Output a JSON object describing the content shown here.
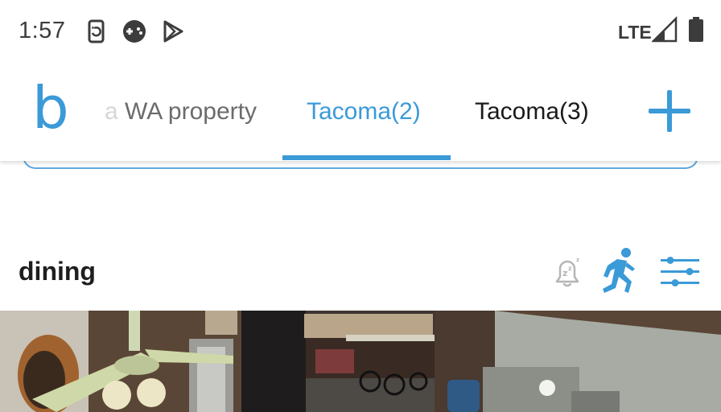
{
  "status_bar": {
    "time": "1:57",
    "network": "LTE",
    "icons": [
      "screen-rotate-icon",
      "gamepad-icon",
      "play-store-icon",
      "signal-icon",
      "battery-icon"
    ]
  },
  "tabs": {
    "logo": "b",
    "items": [
      {
        "fade_text": "a ",
        "label": "WA property",
        "active": false
      },
      {
        "label": "Tacoma(2)",
        "active": true
      },
      {
        "label": "Tacoma(3)",
        "active": false
      }
    ],
    "add_icon": "plus-icon"
  },
  "camera": {
    "name": "dining",
    "actions": [
      "snooze-bell-icon",
      "motion-detect-icon",
      "settings-sliders-icon"
    ]
  },
  "colors": {
    "accent": "#3b9ad8",
    "text": "#1a1a1a",
    "muted_icon": "#b5b5b5"
  }
}
